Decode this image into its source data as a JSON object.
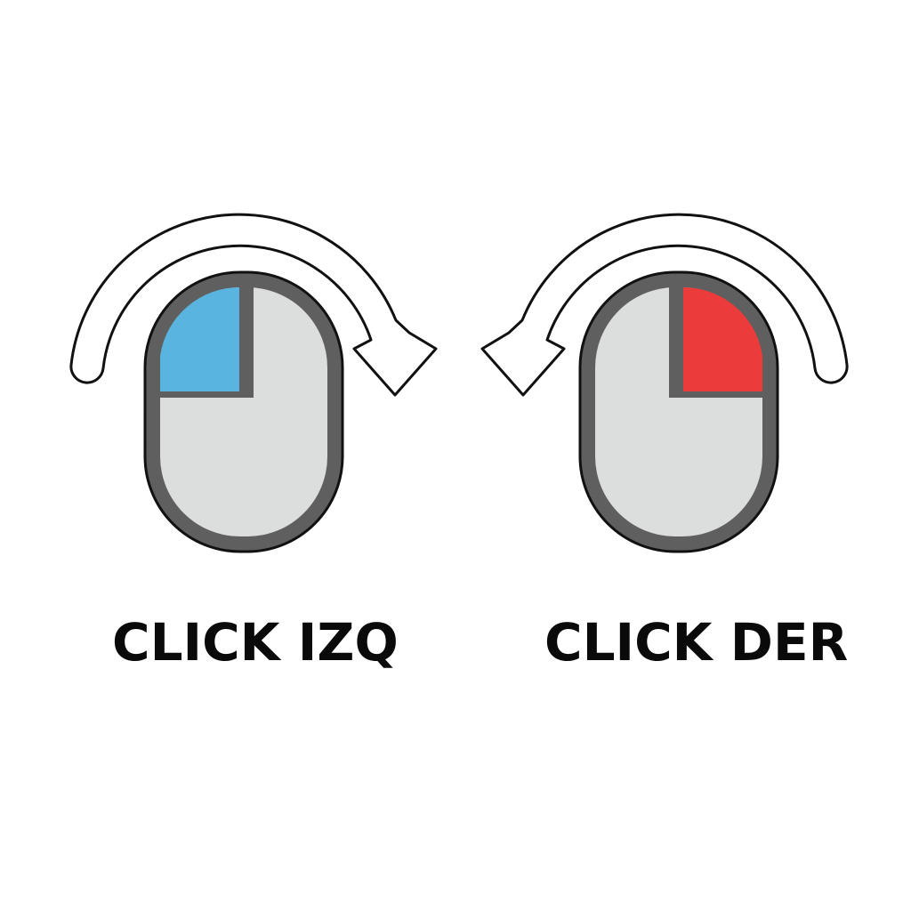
{
  "left": {
    "label": "CLICK IZQ",
    "icon": "mouse-left-click-icon",
    "highlight_color": "#5AB4E0"
  },
  "right": {
    "label": "CLICK DER",
    "icon": "mouse-right-click-icon",
    "highlight_color": "#EB3B3B"
  },
  "colors": {
    "mouse_body": "#DCDDDD",
    "mouse_rim": "#5F5F5F",
    "outline": "#111111",
    "arrow_fill": "#FFFFFF"
  }
}
